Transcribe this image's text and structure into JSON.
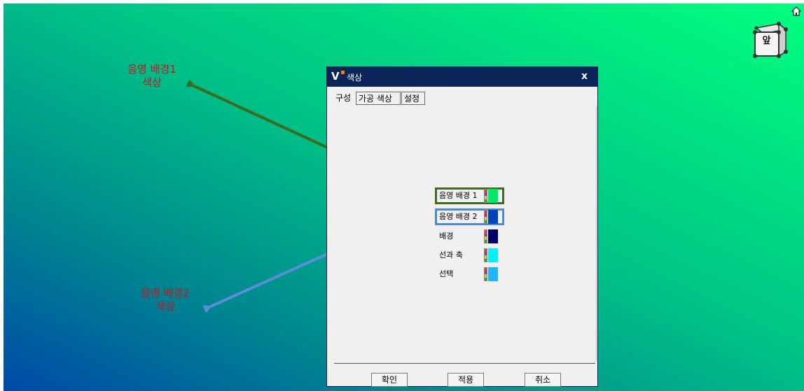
{
  "annotations": {
    "bg1_line1": "음영 배경1",
    "bg1_line2": "색상",
    "bg2_line1": "음영 배경2",
    "bg2_line2": "색상"
  },
  "view_cube": {
    "face_label": "앞",
    "home_icon": "home-icon"
  },
  "dialog": {
    "title": "색상",
    "close_label": "x",
    "tabs": [
      {
        "label": "구성",
        "active": true
      },
      {
        "label": "가공 색상",
        "active": false
      },
      {
        "label": "설정",
        "active": false
      }
    ],
    "color_rows": [
      {
        "label": "음영 배경 1",
        "color": "#00e86a",
        "highlight": "#3b6b1e"
      },
      {
        "label": "음영 배경 2",
        "color": "#0044b8",
        "highlight": "#4f89d2"
      },
      {
        "label": "배경",
        "color": "#00006a"
      },
      {
        "label": "선과 축",
        "color": "#00f0ff"
      },
      {
        "label": "선택",
        "color": "#20b4ff"
      }
    ],
    "buttons": {
      "ok": "확인",
      "apply": "적용",
      "cancel": "취소"
    }
  },
  "colors": {
    "annotation_text": "#c8171b",
    "arrow_bg1": "#3b6b1e",
    "arrow_bg2": "#5a8ed6",
    "title_bar": "#0b2459"
  }
}
